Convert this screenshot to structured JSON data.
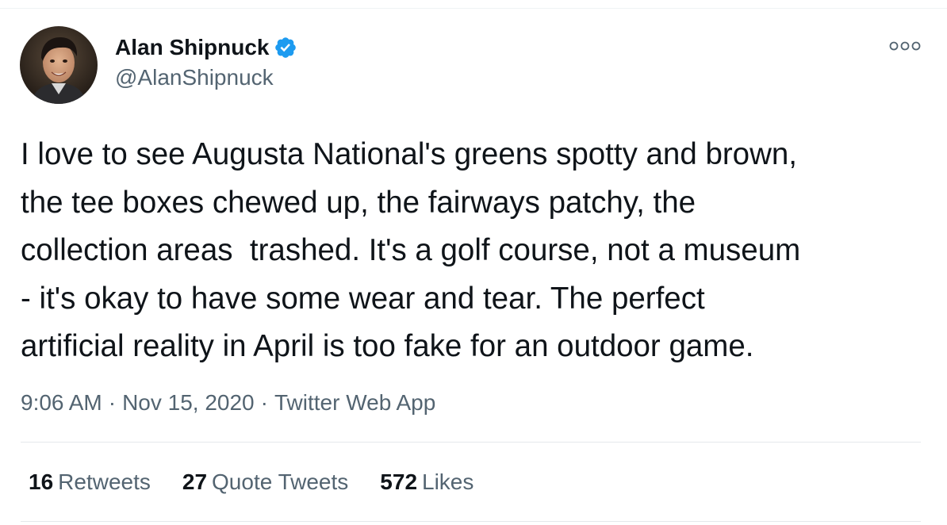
{
  "tweet": {
    "author": {
      "display_name": "Alan Shipnuck",
      "handle": "@AlanShipnuck",
      "verified": true,
      "avatar_icon": "profile-photo"
    },
    "text": "I love to see Augusta National's greens spotty and brown,\nthe tee boxes chewed up, the fairways patchy, the\ncollection areas  trashed. It's a golf course, not a museum\n- it's okay to have some wear and tear. The perfect\nartificial reality in April is too fake for an outdoor game.",
    "time": "9:06 AM",
    "date": "Nov 15, 2020",
    "source": "Twitter Web App",
    "separator": "·",
    "stats": {
      "retweets": {
        "count": "16",
        "label": "Retweets"
      },
      "quote_tweets": {
        "count": "27",
        "label": "Quote Tweets"
      },
      "likes": {
        "count": "572",
        "label": "Likes"
      }
    }
  },
  "colors": {
    "text_primary": "#0f1419",
    "text_secondary": "#536471",
    "verified_blue": "#1d9bf0",
    "divider": "#e4e8eb"
  },
  "icons": {
    "more": "more-options-icon",
    "verified": "verified-badge-icon"
  }
}
